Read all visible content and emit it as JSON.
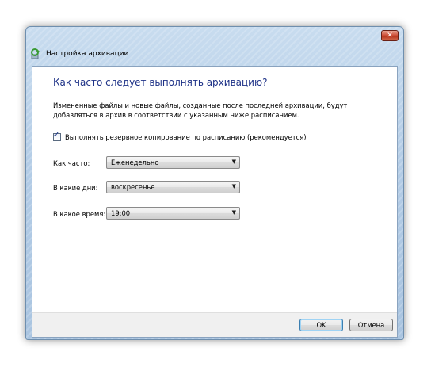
{
  "window": {
    "title": "Настройка архивации",
    "close_glyph": "✕"
  },
  "content": {
    "heading": "Как часто следует выполнять архивацию?",
    "description": "Измененные файлы и новые файлы, созданные после последней архивации, будут добавляться в архив в соответствии с указанным ниже расписанием.",
    "schedule_checkbox": {
      "label": "Выполнять резервное копирование по расписанию (рекомендуется)",
      "checked": true,
      "check_glyph": "✓"
    },
    "fields": {
      "frequency": {
        "label": "Как часто:",
        "value": "Еженедельно"
      },
      "day": {
        "label": "В какие дни:",
        "value": "воскресенье"
      },
      "time": {
        "label": "В какое время:",
        "value": "19:00"
      }
    },
    "dropdown_glyph": "▼"
  },
  "buttons": {
    "ok": "OK",
    "cancel": "Отмена"
  },
  "colors": {
    "heading": "#1e3287",
    "frame": "#b3cce6",
    "close": "#c7452c"
  },
  "icons": {
    "app": "backup-icon",
    "close": "close-icon",
    "dropdown": "chevron-down-icon",
    "checkbox": "checkmark-icon"
  }
}
